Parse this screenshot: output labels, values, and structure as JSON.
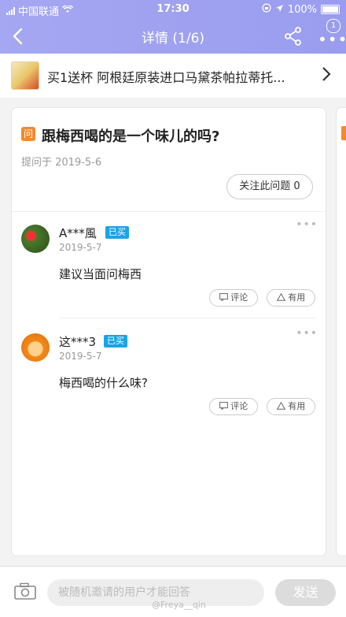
{
  "status_bar": {
    "carrier": "中国联通",
    "time": "17:30",
    "battery": "100%"
  },
  "nav": {
    "title": "详情 (1/6)",
    "badge": "1"
  },
  "product": {
    "name": "买1送杯 阿根廷原装进口马黛茶帕拉蒂托..."
  },
  "question": {
    "tag": "问",
    "title": "跟梅西喝的是一个味儿的吗?",
    "date": "提问于 2019-5-6",
    "follow_label": "关注此问题 0"
  },
  "answers": [
    {
      "username": "A***風",
      "badge": "已买",
      "date": "2019-5-7",
      "content": "建议当面问梅西",
      "comment_label": "评论",
      "useful_label": "有用"
    },
    {
      "username": "这***3",
      "badge": "已买",
      "date": "2019-5-7",
      "content": "梅西喝的什么味?",
      "comment_label": "评论",
      "useful_label": "有用"
    }
  ],
  "bottom": {
    "placeholder": "被随机邀请的用户才能回答",
    "send_label": "发送",
    "watermark": "@Freya__qin"
  }
}
